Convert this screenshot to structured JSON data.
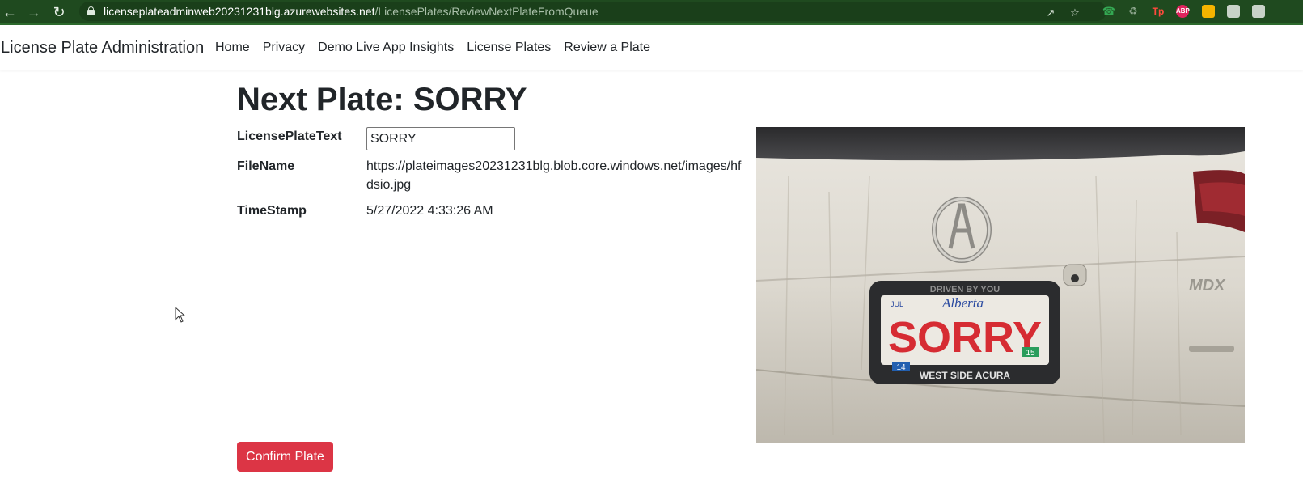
{
  "browser": {
    "url_host": "licenseplateadminweb20231231blg.azurewebsites.net",
    "url_path": "/LicensePlates/ReviewNextPlateFromQueue",
    "extensions": [
      {
        "name": "tp-extension",
        "label": "Tp",
        "color": "#d93025"
      },
      {
        "name": "abp-extension",
        "label": "ABP",
        "color": "#e0245e"
      }
    ]
  },
  "navbar": {
    "brand": "License Plate Administration",
    "links": [
      "Home",
      "Privacy",
      "Demo Live App Insights",
      "License Plates",
      "Review a Plate"
    ]
  },
  "page": {
    "title": "Next Plate: SORRY",
    "fields": {
      "plate_text_label": "LicensePlateText",
      "plate_text_value": "SORRY",
      "filename_label": "FileName",
      "filename_line1": "https://plateimages20231231blg.blob.core.windows.net/images/hf",
      "filename_line2": "dsio.jpg",
      "timestamp_label": "TimeStamp",
      "timestamp_value": "5/27/2022 4:33:26 AM"
    },
    "confirm_button": "Confirm Plate"
  },
  "photo": {
    "plate_text": "SORRY",
    "frame_top": "DRIVEN BY YOU",
    "frame_bottom": "WEST SIDE ACURA",
    "province": "Alberta",
    "month": "JUL",
    "badge_left": "14",
    "badge_right": "15",
    "model_badge": "MDX"
  }
}
